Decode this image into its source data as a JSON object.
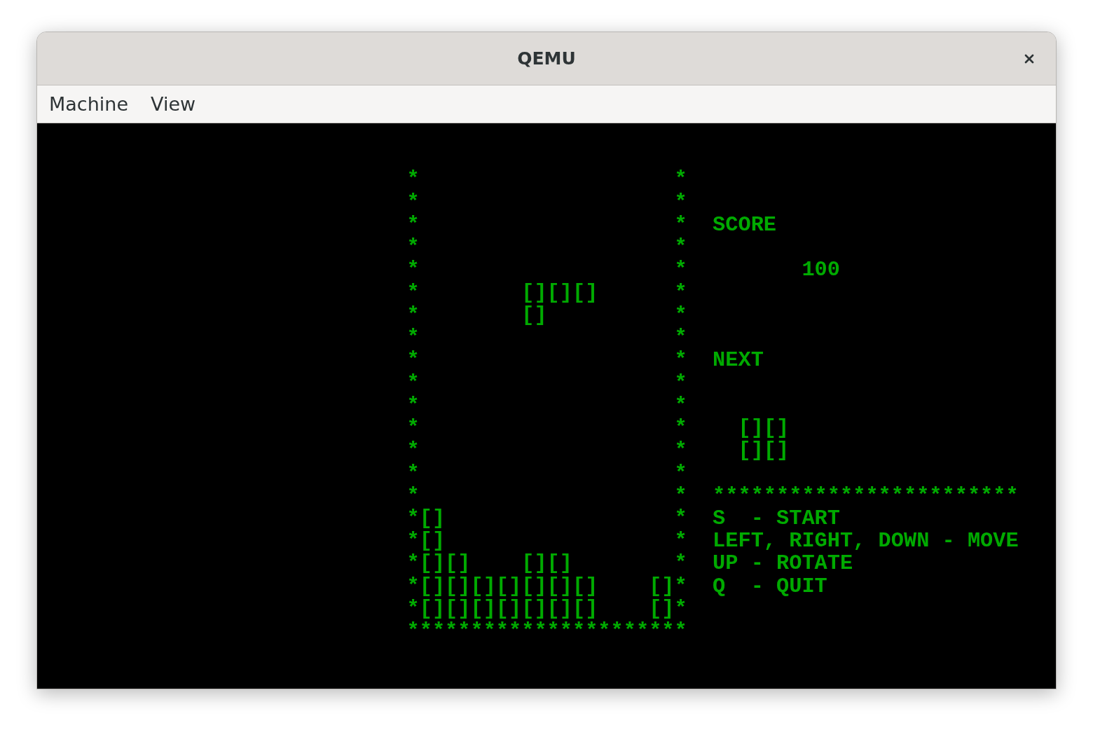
{
  "window": {
    "title": "QEMU"
  },
  "menu_bar": [
    {
      "label": "Machine"
    },
    {
      "label": "View"
    }
  ],
  "screen": {
    "board": {
      "rows": [
        "*                    *",
        "*                    *",
        "*                    *",
        "*                    *",
        "*                    *",
        "*        [][][]      *",
        "*        []          *",
        "*                    *",
        "*                    *",
        "*                    *",
        "*                    *",
        "*                    *",
        "*                    *",
        "*                    *",
        "*                    *",
        "*[]                  *",
        "*[]                  *",
        "*[][]    [][]        *",
        "*[][][][][][][]    []*",
        "*[][][][][][][]    []*"
      ],
      "floor": "**********************"
    },
    "score": {
      "label": "SCORE",
      "value": "100"
    },
    "next": {
      "label": "NEXT",
      "piece": [
        "[][]",
        "[][]"
      ]
    },
    "separator": "************************",
    "help": [
      "S  - START",
      "LEFT, RIGHT, DOWN - MOVE",
      "UP - ROTATE",
      "Q  - QUIT"
    ]
  }
}
